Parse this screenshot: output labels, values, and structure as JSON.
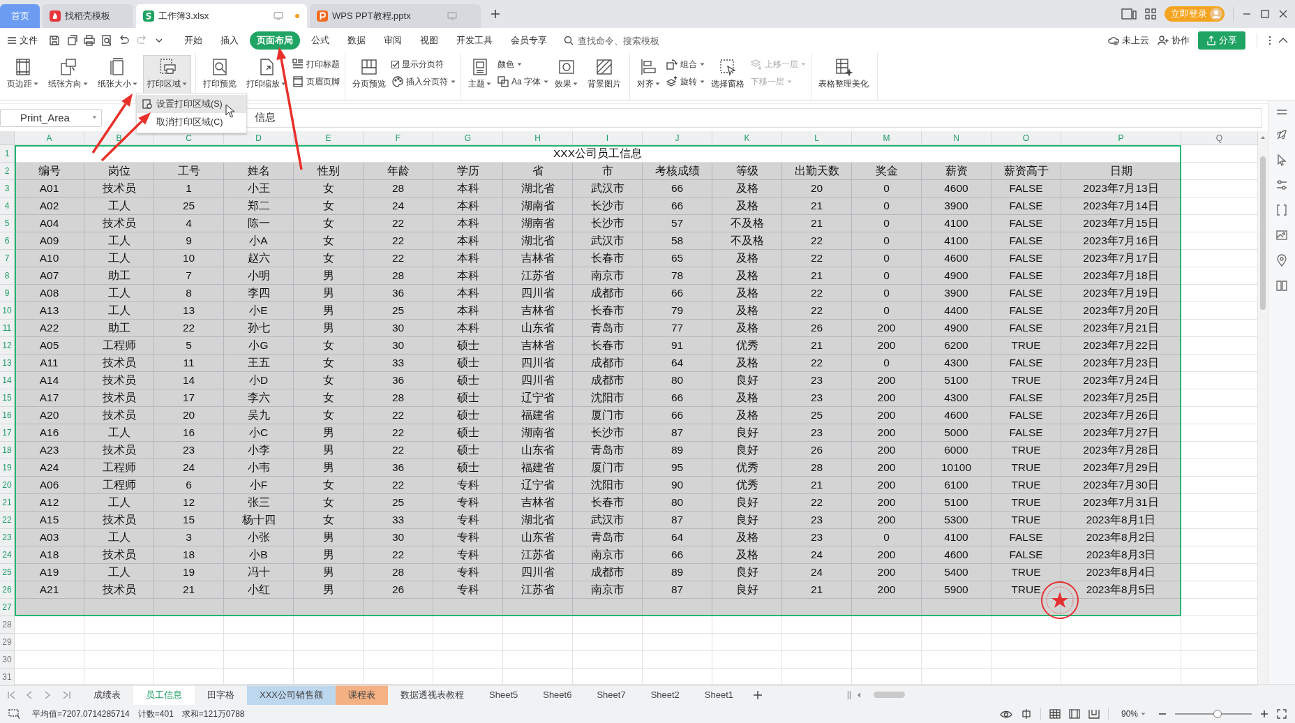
{
  "title_bar": {
    "tabs": [
      {
        "label": "首页",
        "kind": "home",
        "selected": false
      },
      {
        "label": "找稻壳模板",
        "kind": "docer",
        "selected": false
      },
      {
        "label": "工作簿3.xlsx",
        "kind": "sheet",
        "selected": true,
        "modified": true
      },
      {
        "label": "WPS PPT教程.pptx",
        "kind": "slides",
        "selected": false,
        "modified": false
      }
    ],
    "login_button": "立即登录"
  },
  "menu_bar": {
    "file_menu": "文件",
    "tabs": [
      {
        "label": "开始",
        "selected": false
      },
      {
        "label": "插入",
        "selected": false
      },
      {
        "label": "页面布局",
        "selected": true
      },
      {
        "label": "公式",
        "selected": false
      },
      {
        "label": "数据",
        "selected": false
      },
      {
        "label": "审阅",
        "selected": false
      },
      {
        "label": "视图",
        "selected": false
      },
      {
        "label": "开发工具",
        "selected": false
      },
      {
        "label": "会员专享",
        "selected": false
      }
    ],
    "search": {
      "placeholder": "查找命令、搜索模板"
    },
    "cloud_status": "未上云",
    "collaborate": "协作",
    "share_button": "分享"
  },
  "ribbon": {
    "groups": [
      {
        "items": [
          {
            "kind": "large",
            "label": "页边距",
            "dropdown": true,
            "pressed": false
          },
          {
            "kind": "large",
            "label": "纸张方向",
            "dropdown": true,
            "pressed": false
          },
          {
            "kind": "large",
            "label": "纸张大小",
            "dropdown": true,
            "pressed": false
          },
          {
            "kind": "large",
            "label": "打印区域",
            "dropdown": true,
            "pressed": true
          }
        ]
      },
      {
        "items": [
          {
            "kind": "large",
            "label": "打印预览",
            "dropdown": false,
            "pressed": false
          },
          {
            "kind": "large",
            "label": "打印缩放",
            "dropdown": true,
            "pressed": false
          },
          {
            "kind": "stack",
            "items": [
              {
                "kind": "small",
                "label": "打印标题",
                "dropdown": false,
                "disabled": false
              },
              {
                "kind": "small",
                "label": "页眉页脚",
                "dropdown": false,
                "disabled": false
              }
            ]
          }
        ]
      },
      {
        "items": [
          {
            "kind": "large",
            "label": "分页预览",
            "dropdown": false,
            "pressed": false
          },
          {
            "kind": "stack",
            "items": [
              {
                "kind": "checkbox",
                "label": "显示分页符",
                "checked": true,
                "disabled": false
              },
              {
                "kind": "small",
                "label": "插入分页符",
                "dropdown": true,
                "disabled": false
              }
            ]
          }
        ]
      },
      {
        "items": [
          {
            "kind": "large",
            "label": "主题",
            "dropdown": true,
            "pressed": false
          },
          {
            "kind": "stack",
            "items": [
              {
                "kind": "small",
                "label": "颜色",
                "dropdown": true,
                "disabled": false
              },
              {
                "kind": "small",
                "label": "Aa 字体",
                "dropdown": true,
                "disabled": false
              }
            ]
          },
          {
            "kind": "large",
            "label": "效果",
            "dropdown": true,
            "pressed": false
          },
          {
            "kind": "large",
            "label": "背景图片",
            "dropdown": false,
            "pressed": false
          }
        ]
      },
      {
        "items": [
          {
            "kind": "large",
            "label": "对齐",
            "dropdown": true,
            "pressed": false
          },
          {
            "kind": "stack",
            "items": [
              {
                "kind": "small",
                "label": "组合",
                "dropdown": true,
                "disabled": false
              },
              {
                "kind": "small",
                "label": "旋转",
                "dropdown": true,
                "disabled": false
              }
            ]
          },
          {
            "kind": "large",
            "label": "选择窗格",
            "dropdown": false,
            "pressed": false
          },
          {
            "kind": "stack",
            "items": [
              {
                "kind": "small",
                "label": "上移一层",
                "dropdown": true,
                "disabled": true
              },
              {
                "kind": "small",
                "label": "下移一层",
                "dropdown": true,
                "disabled": true
              }
            ]
          }
        ]
      },
      {
        "items": [
          {
            "kind": "large",
            "label": "表格整理美化",
            "dropdown": false,
            "pressed": false
          }
        ]
      }
    ]
  },
  "dropdown_menu": {
    "items": [
      {
        "label": "设置打印区域(S)",
        "selected": true
      },
      {
        "label": "取消打印区域(C)",
        "selected": false
      }
    ]
  },
  "formula_bar": {
    "name_box": "Print_Area",
    "value": "信息"
  },
  "sheet": {
    "columns": [
      {
        "label": "A",
        "selected": true
      },
      {
        "label": "B",
        "selected": true
      },
      {
        "label": "C",
        "selected": true
      },
      {
        "label": "D",
        "selected": true
      },
      {
        "label": "E",
        "selected": true
      },
      {
        "label": "F",
        "selected": true
      },
      {
        "label": "G",
        "selected": true
      },
      {
        "label": "H",
        "selected": true
      },
      {
        "label": "I",
        "selected": true
      },
      {
        "label": "J",
        "selected": true
      },
      {
        "label": "K",
        "selected": true
      },
      {
        "label": "L",
        "selected": true
      },
      {
        "label": "M",
        "selected": true
      },
      {
        "label": "N",
        "selected": true
      },
      {
        "label": "O",
        "selected": true
      },
      {
        "label": "P",
        "selected": true
      },
      {
        "label": "Q",
        "selected": false
      }
    ],
    "row_numbers": [
      {
        "label": "1",
        "selected": true
      },
      {
        "label": "2",
        "selected": true
      },
      {
        "label": "3",
        "selected": true
      },
      {
        "label": "4",
        "selected": true
      },
      {
        "label": "5",
        "selected": true
      },
      {
        "label": "6",
        "selected": true
      },
      {
        "label": "7",
        "selected": true
      },
      {
        "label": "8",
        "selected": true
      },
      {
        "label": "9",
        "selected": true
      },
      {
        "label": "10",
        "selected": true
      },
      {
        "label": "11",
        "selected": true
      },
      {
        "label": "12",
        "selected": true
      },
      {
        "label": "13",
        "selected": true
      },
      {
        "label": "14",
        "selected": true
      },
      {
        "label": "15",
        "selected": true
      },
      {
        "label": "16",
        "selected": true
      },
      {
        "label": "17",
        "selected": true
      },
      {
        "label": "18",
        "selected": true
      },
      {
        "label": "19",
        "selected": true
      },
      {
        "label": "20",
        "selected": true
      },
      {
        "label": "21",
        "selected": true
      },
      {
        "label": "22",
        "selected": true
      },
      {
        "label": "23",
        "selected": true
      },
      {
        "label": "24",
        "selected": true
      },
      {
        "label": "25",
        "selected": true
      },
      {
        "label": "26",
        "selected": true
      },
      {
        "label": "27",
        "selected": true
      },
      {
        "label": "28",
        "selected": false
      },
      {
        "label": "29",
        "selected": false
      },
      {
        "label": "30",
        "selected": false
      },
      {
        "label": "31",
        "selected": false
      }
    ],
    "title": "XXX公司员工信息",
    "header": [
      "编号",
      "岗位",
      "工号",
      "姓名",
      "性别",
      "年龄",
      "学历",
      "省",
      "市",
      "考核成绩",
      "等级",
      "出勤天数",
      "奖金",
      "薪资",
      "薪资高于",
      "日期"
    ],
    "rows": [
      [
        "A01",
        "技术员",
        "1",
        "小王",
        "女",
        "28",
        "本科",
        "湖北省",
        "武汉市",
        "66",
        "及格",
        "20",
        "0",
        "4600",
        "FALSE",
        "2023年7月13日"
      ],
      [
        "A02",
        "工人",
        "25",
        "郑二",
        "女",
        "24",
        "本科",
        "湖南省",
        "长沙市",
        "66",
        "及格",
        "21",
        "0",
        "3900",
        "FALSE",
        "2023年7月14日"
      ],
      [
        "A04",
        "技术员",
        "4",
        "陈一",
        "女",
        "22",
        "本科",
        "湖南省",
        "长沙市",
        "57",
        "不及格",
        "21",
        "0",
        "4100",
        "FALSE",
        "2023年7月15日"
      ],
      [
        "A09",
        "工人",
        "9",
        "小A",
        "女",
        "22",
        "本科",
        "湖北省",
        "武汉市",
        "58",
        "不及格",
        "22",
        "0",
        "4100",
        "FALSE",
        "2023年7月16日"
      ],
      [
        "A10",
        "工人",
        "10",
        "赵六",
        "女",
        "22",
        "本科",
        "吉林省",
        "长春市",
        "65",
        "及格",
        "22",
        "0",
        "4600",
        "FALSE",
        "2023年7月17日"
      ],
      [
        "A07",
        "助工",
        "7",
        "小明",
        "男",
        "28",
        "本科",
        "江苏省",
        "南京市",
        "78",
        "及格",
        "21",
        "0",
        "4900",
        "FALSE",
        "2023年7月18日"
      ],
      [
        "A08",
        "工人",
        "8",
        "李四",
        "男",
        "36",
        "本科",
        "四川省",
        "成都市",
        "66",
        "及格",
        "22",
        "0",
        "3900",
        "FALSE",
        "2023年7月19日"
      ],
      [
        "A13",
        "工人",
        "13",
        "小E",
        "男",
        "25",
        "本科",
        "吉林省",
        "长春市",
        "79",
        "及格",
        "22",
        "0",
        "4400",
        "FALSE",
        "2023年7月20日"
      ],
      [
        "A22",
        "助工",
        "22",
        "孙七",
        "男",
        "30",
        "本科",
        "山东省",
        "青岛市",
        "77",
        "及格",
        "26",
        "200",
        "4900",
        "FALSE",
        "2023年7月21日"
      ],
      [
        "A05",
        "工程师",
        "5",
        "小G",
        "女",
        "30",
        "硕士",
        "吉林省",
        "长春市",
        "91",
        "优秀",
        "21",
        "200",
        "6200",
        "TRUE",
        "2023年7月22日"
      ],
      [
        "A11",
        "技术员",
        "11",
        "王五",
        "女",
        "33",
        "硕士",
        "四川省",
        "成都市",
        "64",
        "及格",
        "22",
        "0",
        "4300",
        "FALSE",
        "2023年7月23日"
      ],
      [
        "A14",
        "技术员",
        "14",
        "小D",
        "女",
        "36",
        "硕士",
        "四川省",
        "成都市",
        "80",
        "良好",
        "23",
        "200",
        "5100",
        "TRUE",
        "2023年7月24日"
      ],
      [
        "A17",
        "技术员",
        "17",
        "李六",
        "女",
        "28",
        "硕士",
        "辽宁省",
        "沈阳市",
        "66",
        "及格",
        "23",
        "200",
        "4300",
        "FALSE",
        "2023年7月25日"
      ],
      [
        "A20",
        "技术员",
        "20",
        "吴九",
        "女",
        "22",
        "硕士",
        "福建省",
        "厦门市",
        "66",
        "及格",
        "25",
        "200",
        "4600",
        "FALSE",
        "2023年7月26日"
      ],
      [
        "A16",
        "工人",
        "16",
        "小C",
        "男",
        "22",
        "硕士",
        "湖南省",
        "长沙市",
        "87",
        "良好",
        "23",
        "200",
        "5000",
        "FALSE",
        "2023年7月27日"
      ],
      [
        "A23",
        "技术员",
        "23",
        "小李",
        "男",
        "22",
        "硕士",
        "山东省",
        "青岛市",
        "89",
        "良好",
        "26",
        "200",
        "6000",
        "TRUE",
        "2023年7月28日"
      ],
      [
        "A24",
        "工程师",
        "24",
        "小韦",
        "男",
        "36",
        "硕士",
        "福建省",
        "厦门市",
        "95",
        "优秀",
        "28",
        "200",
        "10100",
        "TRUE",
        "2023年7月29日"
      ],
      [
        "A06",
        "工程师",
        "6",
        "小F",
        "女",
        "22",
        "专科",
        "辽宁省",
        "沈阳市",
        "90",
        "优秀",
        "21",
        "200",
        "6100",
        "TRUE",
        "2023年7月30日"
      ],
      [
        "A12",
        "工人",
        "12",
        "张三",
        "女",
        "25",
        "专科",
        "吉林省",
        "长春市",
        "80",
        "良好",
        "22",
        "200",
        "5100",
        "TRUE",
        "2023年7月31日"
      ],
      [
        "A15",
        "技术员",
        "15",
        "杨十四",
        "女",
        "33",
        "专科",
        "湖北省",
        "武汉市",
        "87",
        "良好",
        "23",
        "200",
        "5300",
        "TRUE",
        "2023年8月1日"
      ],
      [
        "A03",
        "工人",
        "3",
        "小张",
        "男",
        "30",
        "专科",
        "山东省",
        "青岛市",
        "64",
        "及格",
        "23",
        "0",
        "4100",
        "FALSE",
        "2023年8月2日"
      ],
      [
        "A18",
        "技术员",
        "18",
        "小B",
        "男",
        "22",
        "专科",
        "江苏省",
        "南京市",
        "66",
        "及格",
        "24",
        "200",
        "4600",
        "FALSE",
        "2023年8月3日"
      ],
      [
        "A19",
        "工人",
        "19",
        "冯十",
        "男",
        "28",
        "专科",
        "四川省",
        "成都市",
        "89",
        "良好",
        "24",
        "200",
        "5400",
        "TRUE",
        "2023年8月4日"
      ],
      [
        "A21",
        "技术员",
        "21",
        "小红",
        "男",
        "26",
        "专科",
        "江苏省",
        "南京市",
        "87",
        "良好",
        "21",
        "200",
        "5900",
        "TRUE",
        "2023年8月5日"
      ]
    ],
    "stamp": {
      "kind": "seal"
    }
  },
  "sheet_tabs": [
    {
      "label": "成绩表",
      "selected": false
    },
    {
      "label": "员工信息",
      "selected": true
    },
    {
      "label": "田字格",
      "selected": false
    },
    {
      "label": "XXX公司销售额",
      "selected": false,
      "color": "#bdd7ee"
    },
    {
      "label": "课程表",
      "selected": false,
      "color": "#f4b183"
    },
    {
      "label": "数据透视表教程",
      "selected": false
    },
    {
      "label": "Sheet5",
      "selected": false
    },
    {
      "label": "Sheet6",
      "selected": false
    },
    {
      "label": "Sheet7",
      "selected": false
    },
    {
      "label": "Sheet2",
      "selected": false
    },
    {
      "label": "Sheet1",
      "selected": false
    }
  ],
  "status_bar": {
    "average": "平均值=7207.0714285714",
    "count": "计数=401",
    "sum": "求和=121万0788",
    "zoom": "90%",
    "zoom_slider": {
      "level": 0.55
    }
  },
  "annotations": [
    {
      "kind": "arrow"
    },
    {
      "kind": "arrow"
    },
    {
      "kind": "arrow"
    }
  ]
}
